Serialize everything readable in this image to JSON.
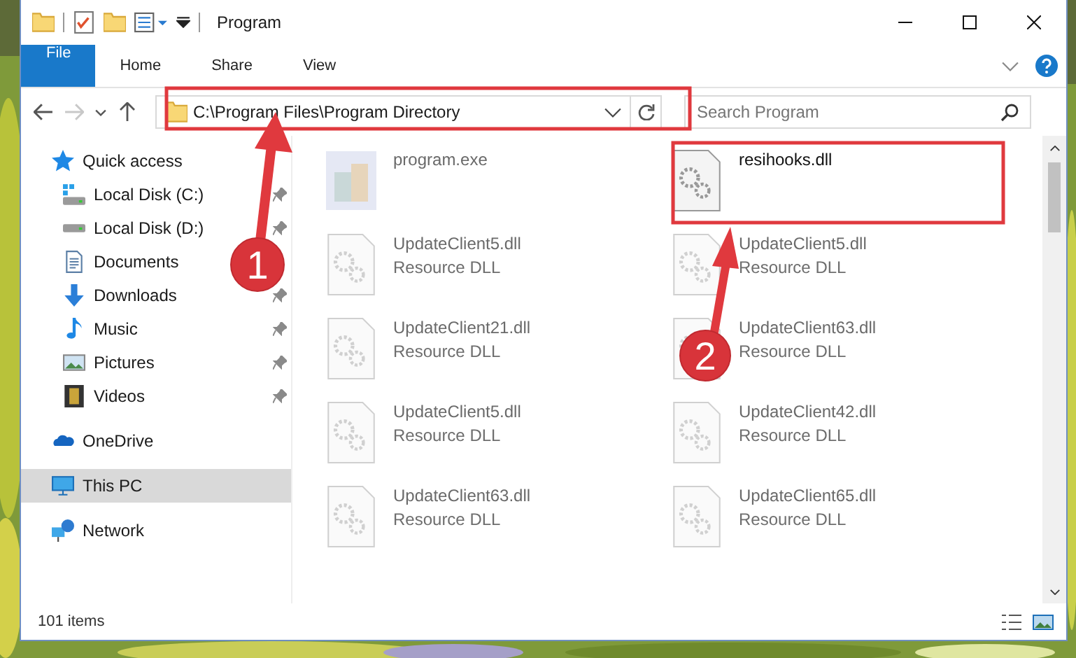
{
  "window": {
    "title": "Program"
  },
  "ribbon": {
    "tabs": [
      {
        "label": "File",
        "kind": "file",
        "selected": false
      },
      {
        "label": "Home",
        "kind": "tab",
        "selected": false
      },
      {
        "label": "Share",
        "kind": "tab",
        "selected": false
      },
      {
        "label": "View",
        "kind": "tab",
        "selected": false
      }
    ]
  },
  "address": {
    "path": "C:\\Program Files\\Program Directory"
  },
  "search": {
    "placeholder": "Search Program"
  },
  "sidebar": {
    "items": [
      {
        "label": "Quick access",
        "kind": "star",
        "selected": false,
        "children": [
          {
            "label": "Local Disk (C:)",
            "kind": "drive-c",
            "pinned": true
          },
          {
            "label": "Local Disk (D:)",
            "kind": "drive",
            "pinned": true
          },
          {
            "label": "Documents",
            "kind": "document"
          },
          {
            "label": "Downloads",
            "kind": "download",
            "pinned": true
          },
          {
            "label": "Music",
            "kind": "music",
            "pinned": true
          },
          {
            "label": "Pictures",
            "kind": "pictures",
            "pinned": true
          },
          {
            "label": "Videos",
            "kind": "videos",
            "pinned": true
          }
        ]
      },
      {
        "label": "OneDrive",
        "kind": "cloud",
        "selected": false
      },
      {
        "label": "This PC",
        "kind": "pc",
        "selected": true
      },
      {
        "label": "Network",
        "kind": "network",
        "selected": false
      }
    ]
  },
  "files": [
    {
      "name": "program.exe",
      "kind": "exe",
      "dimmed": true
    },
    {
      "name": "resihooks.dll",
      "kind": "dll",
      "dimmed": false
    },
    {
      "name": "UpdateClient5.dll",
      "type": "Resource DLL",
      "kind": "dll",
      "dimmed": true
    },
    {
      "name": "UpdateClient5.dll",
      "type": "Resource DLL",
      "kind": "dll",
      "dimmed": true
    },
    {
      "name": "UpdateClient21.dll",
      "type": "Resource DLL",
      "kind": "dll",
      "dimmed": true
    },
    {
      "name": "UpdateClient63.dll",
      "type": "Resource DLL",
      "kind": "dll",
      "dimmed": true
    },
    {
      "name": "UpdateClient5.dll",
      "type": "Resource DLL",
      "kind": "dll",
      "dimmed": true
    },
    {
      "name": "UpdateClient42.dll",
      "type": "Resource DLL",
      "kind": "dll",
      "dimmed": true
    },
    {
      "name": "UpdateClient63.dll",
      "type": "Resource DLL",
      "kind": "dll",
      "dimmed": true
    },
    {
      "name": "UpdateClient65.dll",
      "type": "Resource DLL",
      "kind": "dll",
      "dimmed": true
    }
  ],
  "status_bar": {
    "count": "101 items"
  },
  "annotations": [
    {
      "label": "1"
    },
    {
      "label": "2"
    }
  ]
}
